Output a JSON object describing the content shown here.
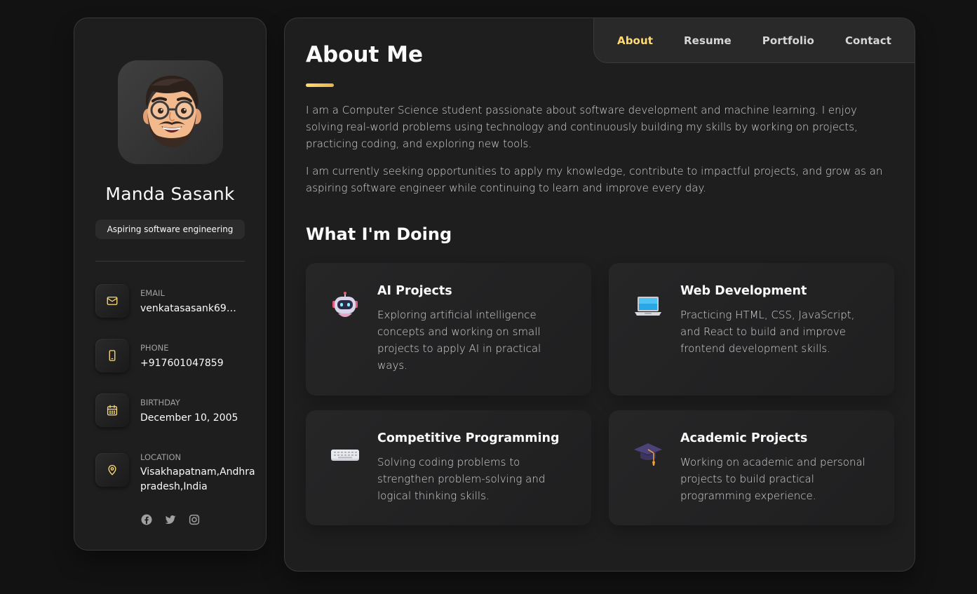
{
  "sidebar": {
    "name": "Manda Sasank",
    "title": "Aspiring software engineering",
    "contacts": [
      {
        "icon": "mail-icon",
        "label": "Email",
        "value": "venkatasasank69@..."
      },
      {
        "icon": "phone-icon",
        "label": "Phone",
        "value": "+917601047859"
      },
      {
        "icon": "calendar-icon",
        "label": "Birthday",
        "value": "December 10, 2005"
      },
      {
        "icon": "location-icon",
        "label": "Location",
        "value": "Visakhapatnam,Andhra pradesh,India"
      }
    ],
    "socials": [
      "facebook-icon",
      "twitter-icon",
      "instagram-icon"
    ]
  },
  "navbar": {
    "links": [
      "About",
      "Resume",
      "Portfolio",
      "Contact"
    ],
    "active": "About"
  },
  "about": {
    "title": "About Me",
    "paragraphs": [
      "I am a Computer Science student passionate about software development and machine learning. I enjoy solving real-world problems using technology and continuously building my skills by working on projects, practicing coding, and exploring new tools.",
      "I am currently seeking opportunities to apply my knowledge, contribute to impactful projects, and grow as an aspiring software engineer while continuing to learn and improve every day."
    ]
  },
  "services": {
    "title": "What I'm Doing",
    "items": [
      {
        "icon": "robot-icon",
        "title": "AI Projects",
        "text": "Exploring artificial intelligence concepts and working on small projects to apply AI in practical ways."
      },
      {
        "icon": "laptop-icon",
        "title": "Web Development",
        "text": "Practicing HTML, CSS, JavaScript, and React to build and improve frontend development skills."
      },
      {
        "icon": "keyboard-icon",
        "title": "Competitive Programming",
        "text": "Solving coding problems to strengthen problem-solving and logical thinking skills."
      },
      {
        "icon": "graduation-cap-icon",
        "title": "Academic Projects",
        "text": "Working on academic and personal projects to build practical programming experience."
      }
    ]
  },
  "colors": {
    "accent": "#ffdb70",
    "background": "#121212",
    "panel": "#1e1e1f"
  }
}
